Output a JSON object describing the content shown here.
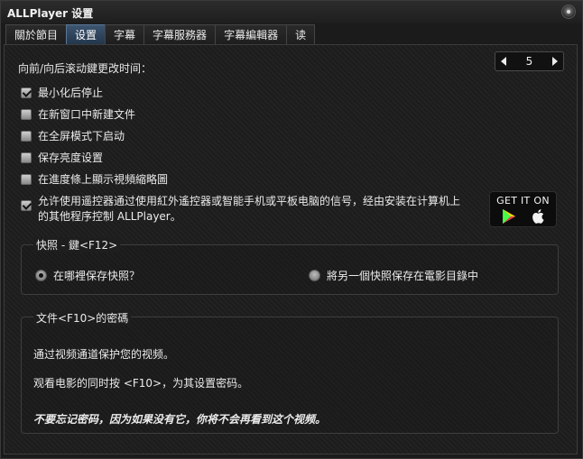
{
  "window": {
    "title": "ALLPlayer 设置"
  },
  "tabs": [
    {
      "label": "關於節目",
      "active": false
    },
    {
      "label": "设置",
      "active": true
    },
    {
      "label": "字幕",
      "active": false
    },
    {
      "label": "字幕服務器",
      "active": false
    },
    {
      "label": "字幕編輯器",
      "active": false
    },
    {
      "label": "读",
      "active": false
    }
  ],
  "scroll": {
    "label": "向前/向后滚动鍵更改时间：",
    "value": "5"
  },
  "options": [
    {
      "label": "最小化后停止",
      "checked": true
    },
    {
      "label": "在新窗口中新建文件",
      "checked": false
    },
    {
      "label": "在全屏模式下启动",
      "checked": false
    },
    {
      "label": "保存亮度设置",
      "checked": false
    },
    {
      "label": "在進度條上顯示視頻縮略圖",
      "checked": false
    },
    {
      "label_line1": "允许使用遥控器通过使用紅外遙控器或智能手机或平板电脑的信号，经由安装在计算机上",
      "label_line2": "的其他程序控制 ALLPlayer。",
      "checked": true
    }
  ],
  "store": {
    "text": "GET IT ON",
    "icons": [
      "google-play-icon",
      "apple-icon"
    ]
  },
  "snapshot": {
    "title": "快照 - 鍵<F12>",
    "option1": {
      "label": "在哪裡保存快照？",
      "selected": true
    },
    "option2": {
      "label": "將另一個快照保存在電影目錄中",
      "selected": false
    }
  },
  "password": {
    "title": "文件<F10>的密碼",
    "line1": "通过视频通道保护您的视频。",
    "line2": "观看电影的同时按 <F10>，为其设置密码。",
    "line3": "不要忘记密码，因为如果没有它，你将不会再看到这个视频。"
  }
}
